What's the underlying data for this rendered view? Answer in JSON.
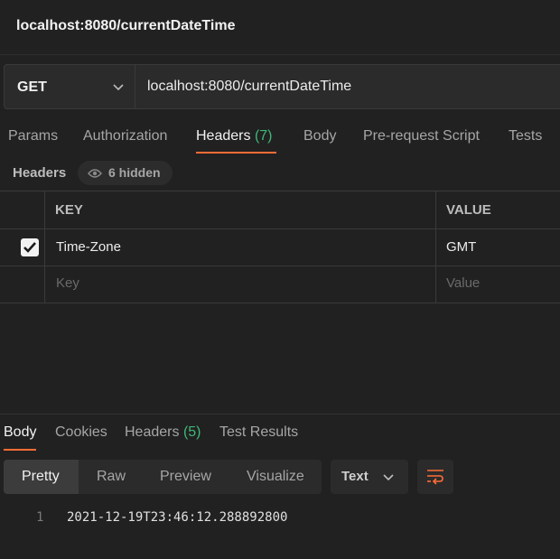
{
  "title": "localhost:8080/currentDateTime",
  "request": {
    "method": "GET",
    "url": "localhost:8080/currentDateTime"
  },
  "request_tabs": {
    "params": "Params",
    "authorization": "Authorization",
    "headers": "Headers",
    "headers_count": "(7)",
    "body": "Body",
    "prerequest": "Pre-request Script",
    "tests": "Tests"
  },
  "headers_section": {
    "label": "Headers",
    "hidden": "6 hidden"
  },
  "table": {
    "key_header": "KEY",
    "value_header": "VALUE",
    "rows": [
      {
        "key": "Time-Zone",
        "value": "GMT",
        "checked": true
      }
    ],
    "placeholder": {
      "key": "Key",
      "value": "Value"
    }
  },
  "response_tabs": {
    "body": "Body",
    "cookies": "Cookies",
    "headers": "Headers",
    "headers_count": "(5)",
    "test_results": "Test Results"
  },
  "view_options": {
    "pretty": "Pretty",
    "raw": "Raw",
    "preview": "Preview",
    "visualize": "Visualize"
  },
  "format": "Text",
  "response_body": {
    "line_number": "1",
    "text": "2021-12-19T23:46:12.288892800"
  },
  "colors": {
    "accent": "#ff6c37",
    "count_green": "#3fb878",
    "background": "#212121"
  },
  "icons": {
    "method_dropdown": "chevron-down-icon",
    "hidden": "eye-icon",
    "checkbox": "checkmark-icon",
    "format_dropdown": "chevron-down-icon",
    "wrap": "text-wrap-icon"
  }
}
